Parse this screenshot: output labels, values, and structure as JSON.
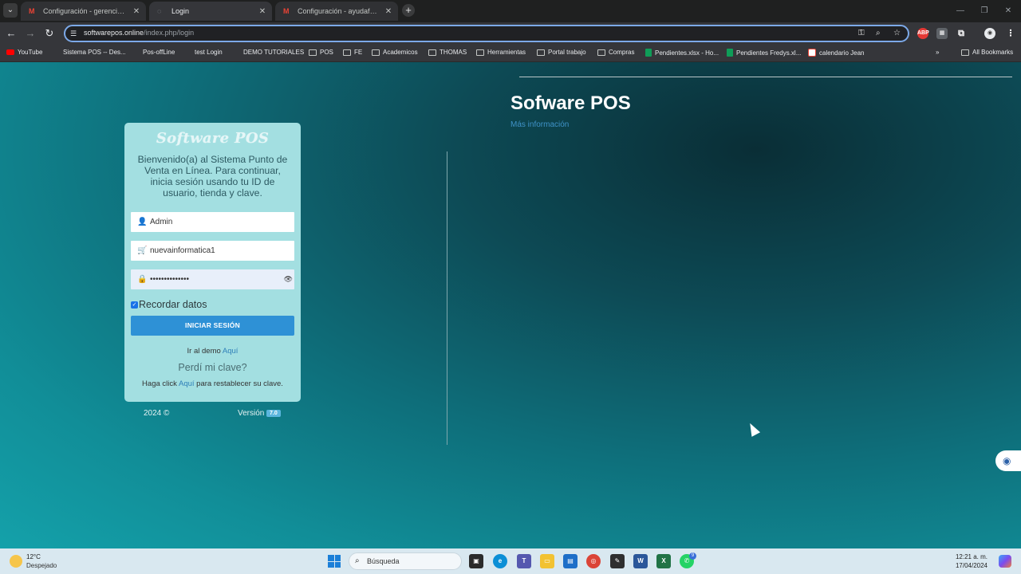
{
  "browser": {
    "tabs": [
      {
        "title": "Configuración - gerencia@nue",
        "favicon": "gmail-icon"
      },
      {
        "title": "Login",
        "favicon": "blank-page-icon"
      },
      {
        "title": "Configuración - ayudafacilpos@",
        "favicon": "gmail-icon"
      }
    ],
    "address": {
      "host": "softwarepos.online",
      "path": "/index.php/login"
    },
    "bookmarks": [
      {
        "label": "YouTube",
        "icon": "youtube-icon"
      },
      {
        "label": "Sistema POS -- Des...",
        "icon": "page-icon"
      },
      {
        "label": "Pos-offLine",
        "icon": "page-icon"
      },
      {
        "label": "test Login",
        "icon": "page-icon"
      },
      {
        "label": "DEMO TUTORIALES",
        "icon": "page-icon"
      },
      {
        "label": "POS",
        "icon": "folder-icon"
      },
      {
        "label": "FE",
        "icon": "folder-icon"
      },
      {
        "label": "Academicos",
        "icon": "folder-icon"
      },
      {
        "label": "THOMAS",
        "icon": "folder-icon"
      },
      {
        "label": "Herramientas",
        "icon": "folder-icon"
      },
      {
        "label": "Portal trabajo",
        "icon": "folder-icon"
      },
      {
        "label": "Compras",
        "icon": "folder-icon"
      },
      {
        "label": "Pendientes.xlsx - Ho...",
        "icon": "sheets-icon"
      },
      {
        "label": "Pendientes Fredys.xl...",
        "icon": "sheets-icon"
      },
      {
        "label": "calendario Jean",
        "icon": "calendar-icon"
      }
    ],
    "overflow": "»",
    "all_bookmarks": "All Bookmarks"
  },
  "page": {
    "hero_title": "Sofware POS",
    "hero_link": "Más información",
    "login": {
      "logo": "Software POS",
      "welcome": "Bienvenido(a) al Sistema Punto de Venta en Línea. Para continuar, inicia sesión usando tu ID de usuario, tienda y clave.",
      "user_value": "Admin",
      "store_value": "nuevainformatica1",
      "password_value": "••••••••••••••",
      "remember_label": "Recordar datos",
      "submit_label": "INICIAR SESIÓN",
      "demo_text": "Ir al demo ",
      "demo_link": "Aquí",
      "lost_password": "Perdí mi clave?",
      "reset_prefix": "Haga click ",
      "reset_link": "Aquí",
      "reset_suffix": " para restablecer su clave."
    },
    "footer": {
      "year": "2024 ©",
      "version_label": "Versión",
      "version_value": "7.0"
    }
  },
  "taskbar": {
    "temperature": "12°C",
    "weather": "Despejado",
    "search_placeholder": "Búsqueda",
    "time": "12:21 a. m.",
    "date": "17/04/2024",
    "whatsapp_badge": "9"
  },
  "colors": {
    "accent": "#2e91d6",
    "card": "#a3dfe1",
    "hero_link": "#3f92c8"
  }
}
